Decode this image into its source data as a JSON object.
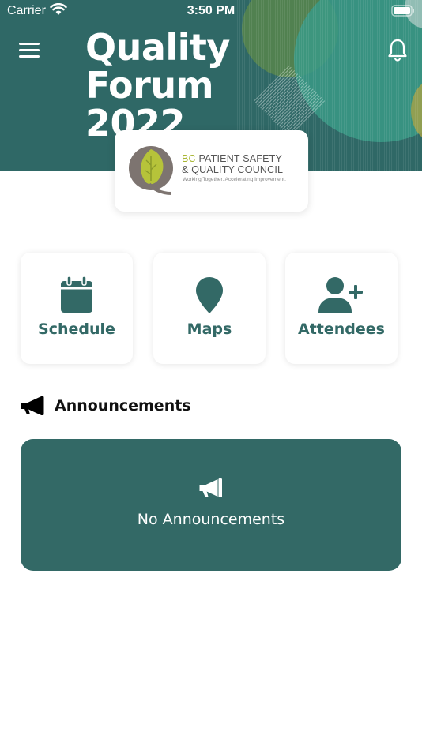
{
  "status_bar": {
    "carrier": "Carrier",
    "time": "3:50 PM"
  },
  "header": {
    "title_line1": "Quality",
    "title_line2": "Forum",
    "title_line3": "2022",
    "background_color": "#2f6866"
  },
  "logo": {
    "org_prefix": "BC",
    "org_line1_rest": " PATIENT SAFETY",
    "org_line2": "& QUALITY COUNCIL",
    "tagline": "Working Together. Accelerating Improvement."
  },
  "tiles": [
    {
      "label": "Schedule",
      "icon": "calendar-icon"
    },
    {
      "label": "Maps",
      "icon": "map-pin-icon"
    },
    {
      "label": "Attendees",
      "icon": "add-person-icon"
    }
  ],
  "announcements": {
    "heading": "Announcements",
    "empty_text": "No Announcements",
    "card_color": "#336966"
  },
  "colors": {
    "accent": "#336966",
    "logo_green": "#a8b632"
  }
}
